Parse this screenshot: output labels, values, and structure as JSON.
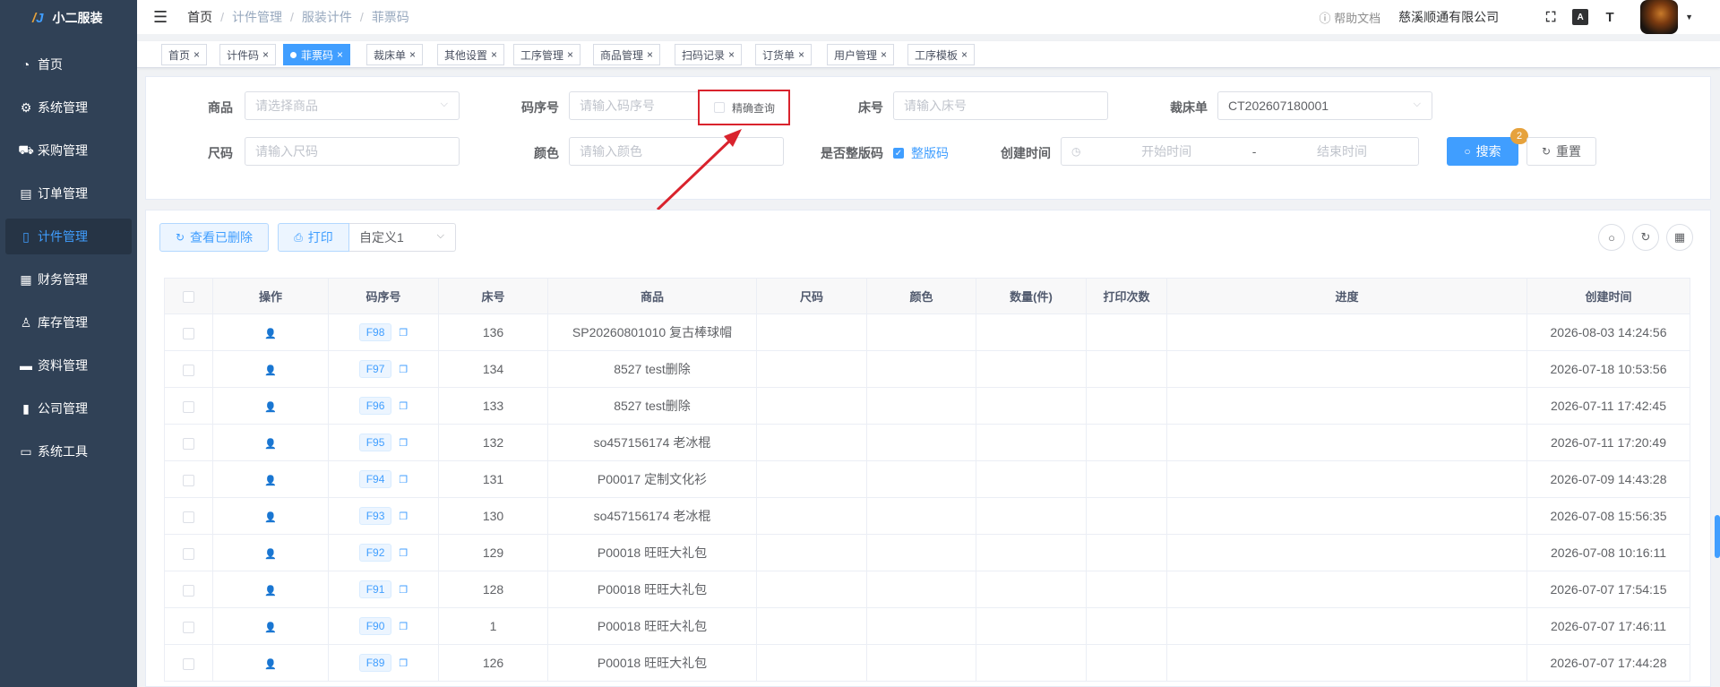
{
  "app": {
    "title": "小二服装"
  },
  "sidebar": {
    "items": [
      {
        "label": "首页",
        "icon": "dashboard-icon",
        "glyph": "◔"
      },
      {
        "label": "系统管理",
        "icon": "gear-icon",
        "glyph": "⚙"
      },
      {
        "label": "采购管理",
        "icon": "cart-icon",
        "glyph": "⛟"
      },
      {
        "label": "订单管理",
        "icon": "order-icon",
        "glyph": "▤"
      },
      {
        "label": "计件管理",
        "icon": "book-icon",
        "glyph": "▯"
      },
      {
        "label": "财务管理",
        "icon": "chart-board-icon",
        "glyph": "▦"
      },
      {
        "label": "库存管理",
        "icon": "user-icon",
        "glyph": "♙"
      },
      {
        "label": "资料管理",
        "icon": "document-icon",
        "glyph": "▬"
      },
      {
        "label": "公司管理",
        "icon": "bar-chart-icon",
        "glyph": "▮"
      },
      {
        "label": "系统工具",
        "icon": "toolbox-icon",
        "glyph": "▭"
      }
    ],
    "active": "计件管理"
  },
  "header": {
    "breadcrumb": [
      "首页",
      "计件管理",
      "服装计件",
      "菲票码"
    ],
    "help": "帮助文档",
    "company": "慈溪顺通有限公司",
    "icon_a": "A",
    "icon_t": "T"
  },
  "tags": [
    {
      "label": "首页"
    },
    {
      "label": "计件码"
    },
    {
      "label": "菲票码",
      "active": true
    },
    {
      "label": "裁床单"
    },
    {
      "label": "其他设置"
    },
    {
      "label": "工序管理"
    },
    {
      "label": "商品管理"
    },
    {
      "label": "扫码记录"
    },
    {
      "label": "订货单"
    },
    {
      "label": "用户管理"
    },
    {
      "label": "工序模板"
    }
  ],
  "search": {
    "product_label": "商品",
    "product_placeholder": "请选择商品",
    "code_label": "码序号",
    "code_placeholder": "请输入码序号",
    "exact_label": "精确查询",
    "bed_label": "床号",
    "bed_placeholder": "请输入床号",
    "cut_label": "裁床单",
    "cut_value": "CT202607180001",
    "size_label": "尺码",
    "size_placeholder": "请输入尺码",
    "color_label": "颜色",
    "color_placeholder": "请输入颜色",
    "whole_label": "是否整版码",
    "whole_check_label": "整版码",
    "time_label": "创建时间",
    "time_start": "开始时间",
    "time_sep": "-",
    "time_end": "结束时间",
    "search_btn": "搜索",
    "search_badge": "2",
    "reset_btn": "重置"
  },
  "toolbar": {
    "deleted_btn": "查看已删除",
    "print_btn": "打印",
    "template_value": "自定义1"
  },
  "table": {
    "columns": [
      "操作",
      "码序号",
      "床号",
      "商品",
      "尺码",
      "颜色",
      "数量(件)",
      "打印次数",
      "进度",
      "创建时间"
    ],
    "rows": [
      {
        "code": "F98",
        "bed": "136",
        "product": "SP20260801010 复古棒球帽",
        "size": "",
        "color": "",
        "qty": "",
        "prints": "",
        "progress": "",
        "created": "2026-08-03 14:24:56"
      },
      {
        "code": "F97",
        "bed": "134",
        "product": "8527 test删除",
        "size": "",
        "color": "",
        "qty": "",
        "prints": "",
        "progress": "",
        "created": "2026-07-18 10:53:56"
      },
      {
        "code": "F96",
        "bed": "133",
        "product": "8527 test删除",
        "size": "",
        "color": "",
        "qty": "",
        "prints": "",
        "progress": "",
        "created": "2026-07-11 17:42:45"
      },
      {
        "code": "F95",
        "bed": "132",
        "product": "so457156174 老冰棍",
        "size": "",
        "color": "",
        "qty": "",
        "prints": "",
        "progress": "",
        "created": "2026-07-11 17:20:49"
      },
      {
        "code": "F94",
        "bed": "131",
        "product": "P00017 定制文化衫",
        "size": "",
        "color": "",
        "qty": "",
        "prints": "",
        "progress": "",
        "created": "2026-07-09 14:43:28"
      },
      {
        "code": "F93",
        "bed": "130",
        "product": "so457156174 老冰棍",
        "size": "",
        "color": "",
        "qty": "",
        "prints": "",
        "progress": "",
        "created": "2026-07-08 15:56:35"
      },
      {
        "code": "F92",
        "bed": "129",
        "product": "P00018 旺旺大礼包",
        "size": "",
        "color": "",
        "qty": "",
        "prints": "",
        "progress": "",
        "created": "2026-07-08 10:16:11"
      },
      {
        "code": "F91",
        "bed": "128",
        "product": "P00018 旺旺大礼包",
        "size": "",
        "color": "",
        "qty": "",
        "prints": "",
        "progress": "",
        "created": "2026-07-07 17:54:15"
      },
      {
        "code": "F90",
        "bed": "1",
        "product": "P00018 旺旺大礼包",
        "size": "",
        "color": "",
        "qty": "",
        "prints": "",
        "progress": "",
        "created": "2026-07-07 17:46:11"
      },
      {
        "code": "F89",
        "bed": "126",
        "product": "P00018 旺旺大礼包",
        "size": "",
        "color": "",
        "qty": "",
        "prints": "",
        "progress": "",
        "created": "2026-07-07 17:44:28"
      }
    ]
  },
  "colors": {
    "primary": "#409eff",
    "sidebar": "#304156",
    "highlight": "#d9232d",
    "badge": "#e6a23c"
  }
}
